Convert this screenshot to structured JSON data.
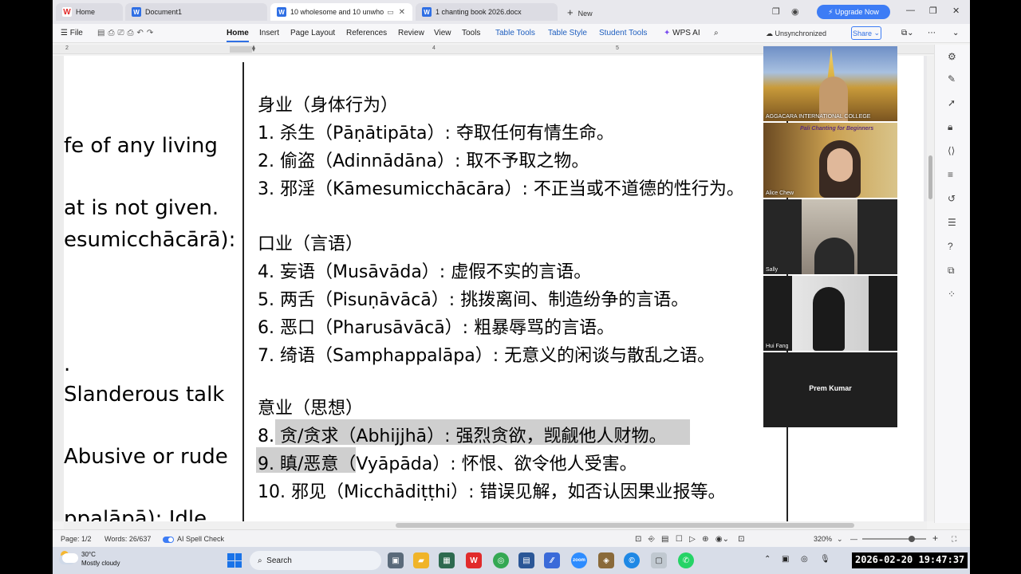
{
  "tabs": [
    {
      "label": "Home",
      "icon": "wps-icon"
    },
    {
      "label": "Document1",
      "icon": "word-icon"
    },
    {
      "label": "10 wholesome and  10 unwho",
      "icon": "word-icon"
    },
    {
      "label": "1 chanting book 2026.docx",
      "icon": "word-icon"
    }
  ],
  "new_tab_label": "New",
  "upgrade_label": "Upgrade Now",
  "menu": [
    "File",
    "Home",
    "Insert",
    "Page Layout",
    "References",
    "Review",
    "View",
    "Tools",
    "Table Tools",
    "Table Style",
    "Student Tools",
    "WPS AI"
  ],
  "unsync_label": "Unsynchronized",
  "share_label": "Share",
  "ruler_numbers": [
    "2",
    "4",
    "5"
  ],
  "left_column": [
    "fe  of  any  living",
    "at is not given.",
    "esumicchācārā):",
    ".",
    "Slanderous  talk",
    "Abusive  or  rude",
    "ppalāpā):   Idle"
  ],
  "right_column": {
    "h1": "身业（身体行为）",
    "l1": "1. 杀生（Pāṇātipāta）: 夺取任何有情生命。",
    "l2": "2. 偷盗（Adinnādāna）: 取不予取之物。",
    "l3": "3. 邪淫（Kāmesumicchācāra）: 不正当或不道德的性行为。",
    "h2": "口业（言语）",
    "l4": "4. 妄语（Musāvāda）: 虚假不实的言语。",
    "l5": "5. 两舌（Pisuṇāvācā）: 挑拨离间、制造纷争的言语。",
    "l6": "6. 恶口（Pharusāvācā）: 粗暴辱骂的言语。",
    "l7": "7. 绮语（Samphappalāpa）: 无意义的闲谈与散乱之语。",
    "h3": "意业（思想）",
    "l8": "8. 贪/贪求（Abhijjhā）: 强烈贪欲，觊觎他人财物。",
    "l9": "9. 瞋/恶意（Vyāpāda）: 怀恨、欲令他人受害。",
    "l10": "10. 邪见（Micchādiṭṭhi）: 错误见解，如否认因果业报等。"
  },
  "participants": [
    {
      "name": "AGGACARA INTERNATIONAL COLLEGE"
    },
    {
      "name": "Alice Chew",
      "banner": "Pali Chanting for Beginners"
    },
    {
      "name": "Sally"
    },
    {
      "name": "Hui Fang"
    },
    {
      "name": "Prem Kumar"
    }
  ],
  "status": {
    "page": "Page: 1/2",
    "words": "Words: 26/637",
    "spell": "AI Spell Check",
    "zoom": "320%"
  },
  "taskbar": {
    "temp": "30°C",
    "weather": "Mostly cloudy",
    "search": "Search",
    "clock": "2026-02-20 19:47:37"
  },
  "colors": {
    "accent": "#2f6fe4",
    "ctx_tab": "#1f5fbf",
    "highlight": "#cfcfcf"
  }
}
